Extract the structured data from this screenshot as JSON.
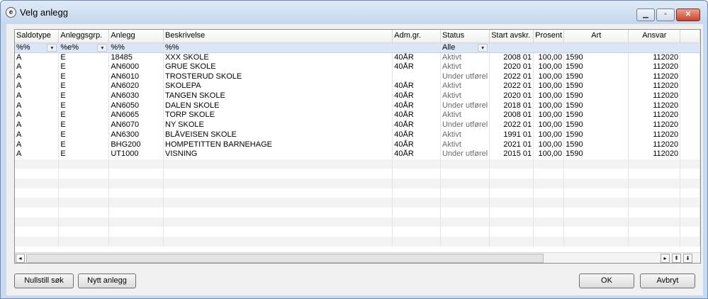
{
  "window": {
    "title": "Velg anlegg"
  },
  "columns": [
    "Saldotype",
    "Anleggsgrp.",
    "Anlegg",
    "Beskrivelse",
    "Adm.gr.",
    "Status",
    "Start avskr.",
    "Prosent",
    "Art",
    "Ansvar"
  ],
  "filters": {
    "saldotype": "%%",
    "anleggsgrp": "%e%",
    "anlegg": "%%",
    "beskrivelse": "%%",
    "status": "Alle"
  },
  "rows": [
    [
      "A",
      "E",
      "18485",
      "XXX SKOLE",
      "40ÅR",
      "Aktivt",
      "2008 01",
      "100,00",
      "1590",
      "112020"
    ],
    [
      "A",
      "E",
      "AN6000",
      "GRUE SKOLE",
      "40ÅR",
      "Aktivt",
      "2020 01",
      "100,00",
      "1590",
      "112020"
    ],
    [
      "A",
      "E",
      "AN6010",
      "TROSTERUD SKOLE",
      "",
      "Under utførel",
      "2022 01",
      "100,00",
      "1590",
      "112020"
    ],
    [
      "A",
      "E",
      "AN6020",
      "SKOLEPA",
      "40ÅR",
      "Aktivt",
      "2022 01",
      "100,00",
      "1590",
      "112020"
    ],
    [
      "A",
      "E",
      "AN6030",
      "TANGEN SKOLE",
      "40ÅR",
      "Aktivt",
      "2020 01",
      "100,00",
      "1590",
      "112020"
    ],
    [
      "A",
      "E",
      "AN6050",
      "DALEN SKOLE",
      "40ÅR",
      "Under utførel",
      "2018 01",
      "100,00",
      "1590",
      "112020"
    ],
    [
      "A",
      "E",
      "AN6065",
      "TORP SKOLE",
      "40ÅR",
      "Aktivt",
      "2008 01",
      "100,00",
      "1590",
      "112020"
    ],
    [
      "A",
      "E",
      "AN6070",
      "NY SKOLE",
      "40ÅR",
      "Under utførel",
      "2022 01",
      "100,00",
      "1590",
      "112020"
    ],
    [
      "A",
      "E",
      "AN6300",
      "BLÅVEISEN SKOLE",
      "40ÅR",
      "Aktivt",
      "1991 01",
      "100,00",
      "1590",
      "112020"
    ],
    [
      "A",
      "E",
      "BHG200",
      "HOMPETITTEN BARNEHAGE",
      "40ÅR",
      "Aktivt",
      "2021 01",
      "100,00",
      "1590",
      "112020"
    ],
    [
      "A",
      "E",
      "UT1000",
      "VISNING",
      "40ÅR",
      "Under utførel",
      "2015 01",
      "100,00",
      "1590",
      "112020"
    ]
  ],
  "buttons": {
    "reset_search": "Nullstill søk",
    "new_asset": "Nytt anlegg",
    "ok": "OK",
    "cancel": "Avbryt"
  },
  "icons": {
    "app": "app-logo-icon",
    "minimize": "minimize-icon",
    "maximize": "maximize-icon",
    "close": "close-icon",
    "scroll_left": "arrow-left-icon",
    "scroll_right": "arrow-right-icon",
    "expand": "expand-rows-icon",
    "collapse": "collapse-rows-icon",
    "dropdown": "chevron-down-icon"
  }
}
